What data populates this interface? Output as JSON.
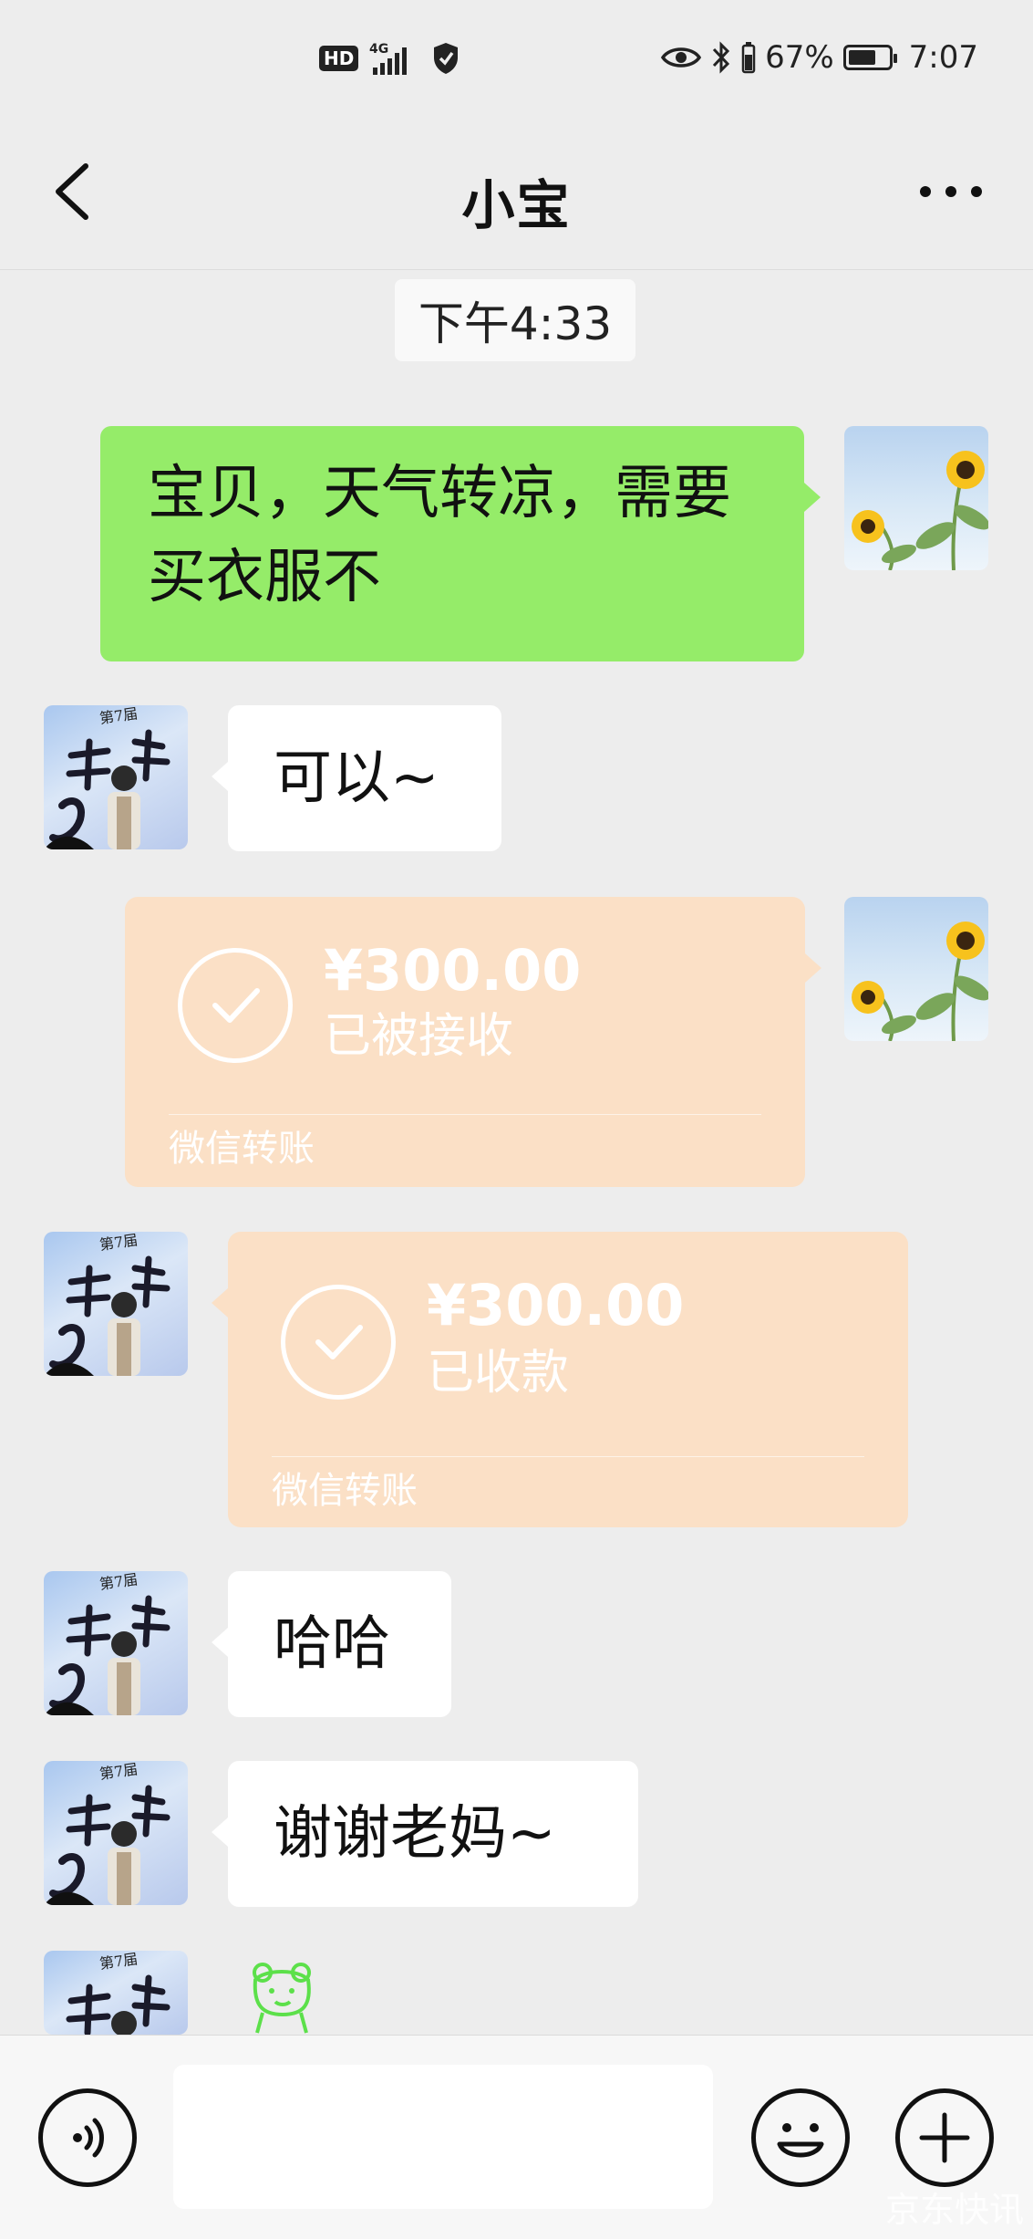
{
  "status_bar": {
    "hd": "HD",
    "network": "4G",
    "battery_percent": "67%",
    "time": "7:07"
  },
  "header": {
    "title": "小宝"
  },
  "timestamp": "下午4:33",
  "messages": [
    {
      "sender": "self",
      "type": "text",
      "text": "宝贝，天气转凉，需要买衣服不"
    },
    {
      "sender": "other",
      "type": "text",
      "text": "可以~"
    },
    {
      "sender": "self",
      "type": "transfer",
      "amount": "¥300.00",
      "status": "已被接收",
      "label": "微信转账"
    },
    {
      "sender": "other",
      "type": "transfer",
      "amount": "¥300.00",
      "status": "已收款",
      "label": "微信转账"
    },
    {
      "sender": "other",
      "type": "text",
      "text": "哈哈"
    },
    {
      "sender": "other",
      "type": "text",
      "text": "谢谢老妈~"
    },
    {
      "sender": "other",
      "type": "sticker",
      "sticker": "green-bear-sticker"
    }
  ],
  "input": {
    "value": "",
    "placeholder": ""
  },
  "watermark": "京东快讯"
}
